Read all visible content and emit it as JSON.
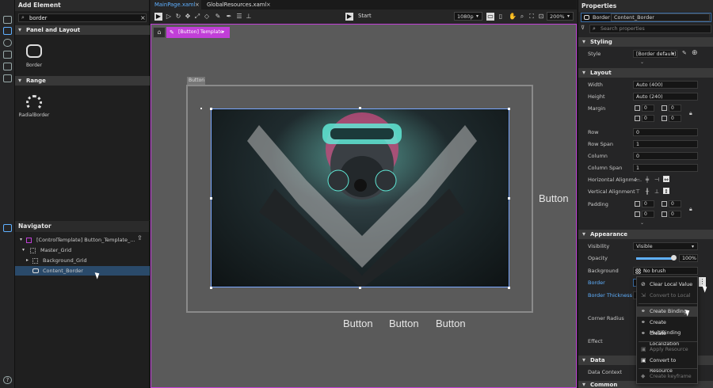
{
  "add_element": {
    "title": "Add Element",
    "search_value": "border",
    "sections": [
      {
        "label": "Panel and Layout",
        "items": [
          {
            "label": "Border",
            "icon": "border-icon"
          }
        ]
      },
      {
        "label": "Range",
        "items": [
          {
            "label": "RadialBorder",
            "icon": "radial-border-icon"
          }
        ]
      }
    ]
  },
  "navigator": {
    "title": "Navigator",
    "items": [
      {
        "label": "[ControlTemplate] Button_Template_...",
        "icon": "control-template-icon"
      },
      {
        "label": "Master_Grid",
        "icon": "grid-icon"
      },
      {
        "label": "Background_Grid",
        "icon": "grid-icon"
      },
      {
        "label": "Content_Border",
        "icon": "border-icon"
      }
    ]
  },
  "tabs": [
    {
      "label": "MainPage.xaml",
      "active": true
    },
    {
      "label": "GlobalResources.xaml",
      "active": false
    }
  ],
  "toolbar": {
    "run_label": "Start",
    "resolution": "1080p",
    "zoom": "200%"
  },
  "canvas": {
    "breadcrumb": "[Button] Template",
    "button_box_label": "Button",
    "button_labels": [
      "Button",
      "Button",
      "Button",
      "Button"
    ],
    "accent": "#c13fd8",
    "selection": "#7aa7ff"
  },
  "properties": {
    "title": "Properties",
    "element_type": "Border",
    "element_name": "Content_Border",
    "search_placeholder": "Search properties",
    "styling": {
      "label": "Styling",
      "style_label": "Style",
      "style_value": "[Border default]"
    },
    "layout": {
      "label": "Layout",
      "width_label": "Width",
      "width_value": "Auto (400)",
      "height_label": "Height",
      "height_value": "Auto (240)",
      "margin_label": "Margin",
      "margin_values": [
        "0",
        "0",
        "0",
        "0"
      ],
      "row_label": "Row",
      "row_value": "0",
      "rowspan_label": "Row Span",
      "rowspan_value": "1",
      "column_label": "Column",
      "column_value": "0",
      "colspan_label": "Column Span",
      "colspan_value": "1",
      "halign_label": "Horizontal Alignme...",
      "valign_label": "Vertical Alignment",
      "padding_label": "Padding",
      "padding_values": [
        "0",
        "0",
        "0",
        "0"
      ]
    },
    "appearance": {
      "label": "Appearance",
      "visibility_label": "Visibility",
      "visibility_value": "Visible",
      "opacity_label": "Opacity",
      "opacity_value": "100%",
      "opacity_level": 1.0,
      "background_label": "Background",
      "background_value": "No brush",
      "border_label": "Border",
      "thickness_label": "Border Thickness",
      "corner_label": "Corner Radius",
      "effect_label": "Effect"
    },
    "data": {
      "label": "Data",
      "datacontext_label": "Data Context"
    },
    "common": {
      "label": "Common"
    }
  },
  "context_menu": {
    "items": [
      {
        "label": "Clear Local Value",
        "icon": "clear-icon",
        "enabled": true
      },
      {
        "label": "Convert to Local",
        "icon": "convert-local-icon",
        "enabled": false
      },
      {
        "label": "Create Binding",
        "icon": "binding-icon",
        "enabled": true
      },
      {
        "label": "Create MultiBinding",
        "icon": "multibinding-icon",
        "enabled": true
      },
      {
        "label": "Create Localization",
        "icon": "localization-icon",
        "enabled": true
      },
      {
        "label": "Apply Resource",
        "icon": "apply-resource-icon",
        "enabled": false
      },
      {
        "label": "Convert to Resource",
        "icon": "convert-resource-icon",
        "enabled": true
      },
      {
        "label": "Create keyframe",
        "icon": "keyframe-icon",
        "enabled": false
      }
    ]
  }
}
